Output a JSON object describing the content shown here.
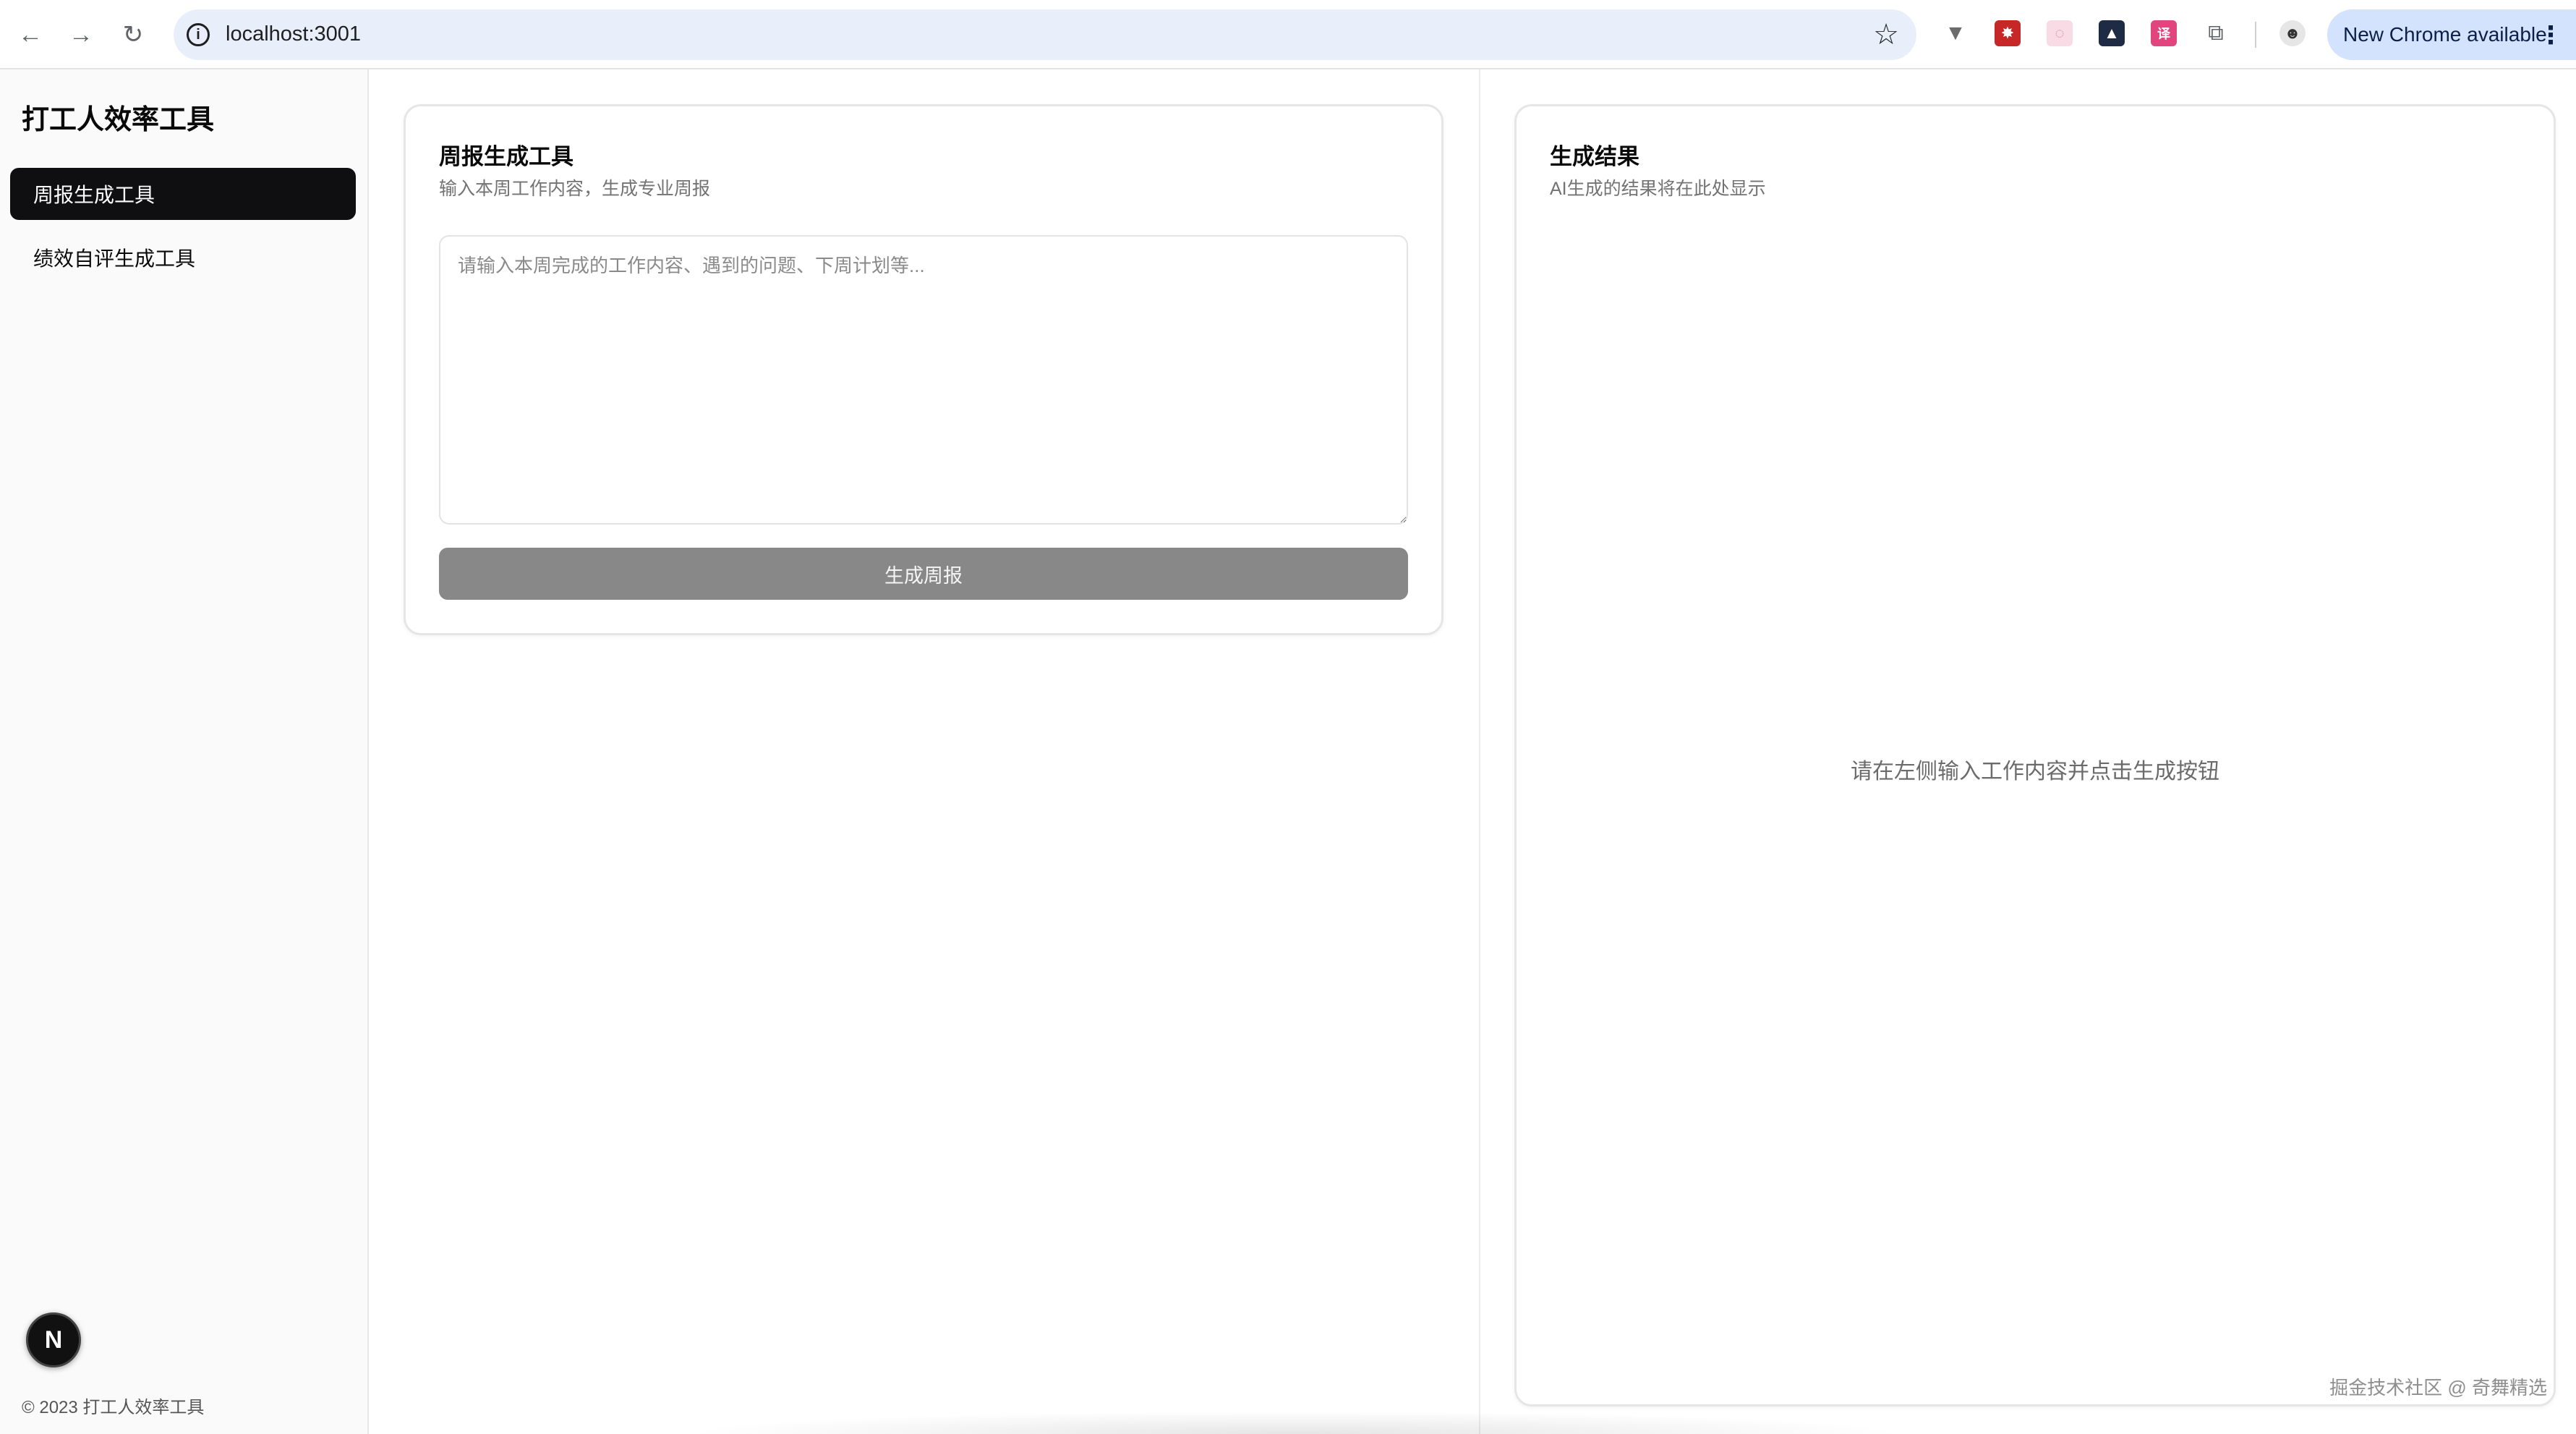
{
  "browser": {
    "url": "localhost:3001",
    "update_label": "New Chrome available",
    "nav_icons": {
      "back": "arrow-left-icon",
      "forward": "arrow-right-icon",
      "reload": "reload-icon"
    },
    "extensions": [
      {
        "name": "vue-devtools-icon",
        "color": "#6b6b6b"
      },
      {
        "name": "ext-red-icon",
        "color": "#c62828"
      },
      {
        "name": "ext-pink-icon",
        "color": "#f3b6c8"
      },
      {
        "name": "ext-dark-icon",
        "color": "#1f2a44"
      },
      {
        "name": "ext-translate-icon",
        "color": "#e0457b"
      },
      {
        "name": "extensions-puzzle-icon",
        "color": "#5f6368"
      },
      {
        "name": "profile-avatar-icon",
        "color": "#e0e0e0"
      }
    ]
  },
  "sidebar": {
    "title": "打工人效率工具",
    "items": [
      {
        "label": "周报生成工具",
        "active": true
      },
      {
        "label": "绩效自评生成工具",
        "active": false
      }
    ],
    "footer": "© 2023 打工人效率工具",
    "badge": "N"
  },
  "input_card": {
    "title": "周报生成工具",
    "subtitle": "输入本周工作内容，生成专业周报",
    "placeholder": "请输入本周完成的工作内容、遇到的问题、下周计划等...",
    "value": "",
    "button_label": "生成周报"
  },
  "result_card": {
    "title": "生成结果",
    "subtitle": "AI生成的结果将在此处显示",
    "empty_hint": "请在左侧输入工作内容并点击生成按钮"
  },
  "watermark": "掘金技术社区 @ 奇舞精选",
  "colors": {
    "accent_active": "#0f0f11",
    "button_disabled": "#888888",
    "update_pill": "#d3e3fd"
  }
}
